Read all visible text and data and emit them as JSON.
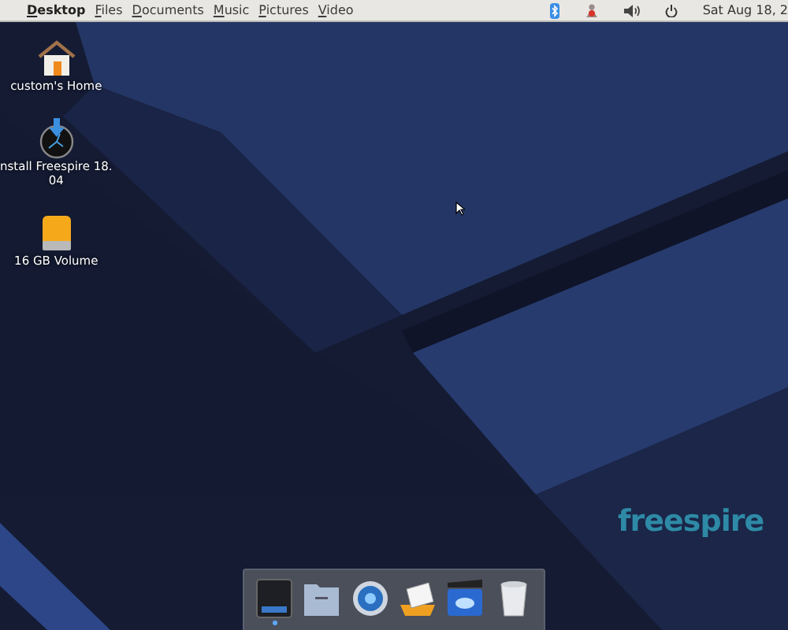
{
  "top_bar": {
    "menus": [
      {
        "label": "Desktop",
        "kind": "app"
      },
      {
        "label": "Files",
        "kind": "menu"
      },
      {
        "label": "Documents",
        "kind": "menu"
      },
      {
        "label": "Music",
        "kind": "menu"
      },
      {
        "label": "Pictures",
        "kind": "menu"
      },
      {
        "label": "Video",
        "kind": "menu"
      }
    ],
    "tray": [
      {
        "kind": "bluetooth"
      },
      {
        "kind": "network"
      },
      {
        "kind": "volume"
      },
      {
        "kind": "power"
      }
    ],
    "clock": "Sat Aug 18, 2"
  },
  "desktop_icons": [
    {
      "kind": "home",
      "label_lines": [
        "custom's Home"
      ]
    },
    {
      "kind": "installer",
      "label_lines": [
        "nstall Freespire 18.",
        "04"
      ]
    },
    {
      "kind": "drive",
      "label_lines": [
        "16 GB Volume"
      ]
    }
  ],
  "wallpaper_logo": "freespire",
  "dock": [
    {
      "kind": "terminal",
      "running": true
    },
    {
      "kind": "folder",
      "running": false
    },
    {
      "kind": "browser",
      "running": false
    },
    {
      "kind": "mail",
      "running": false
    },
    {
      "kind": "video",
      "running": false
    },
    {
      "kind": "trash",
      "running": false
    }
  ]
}
